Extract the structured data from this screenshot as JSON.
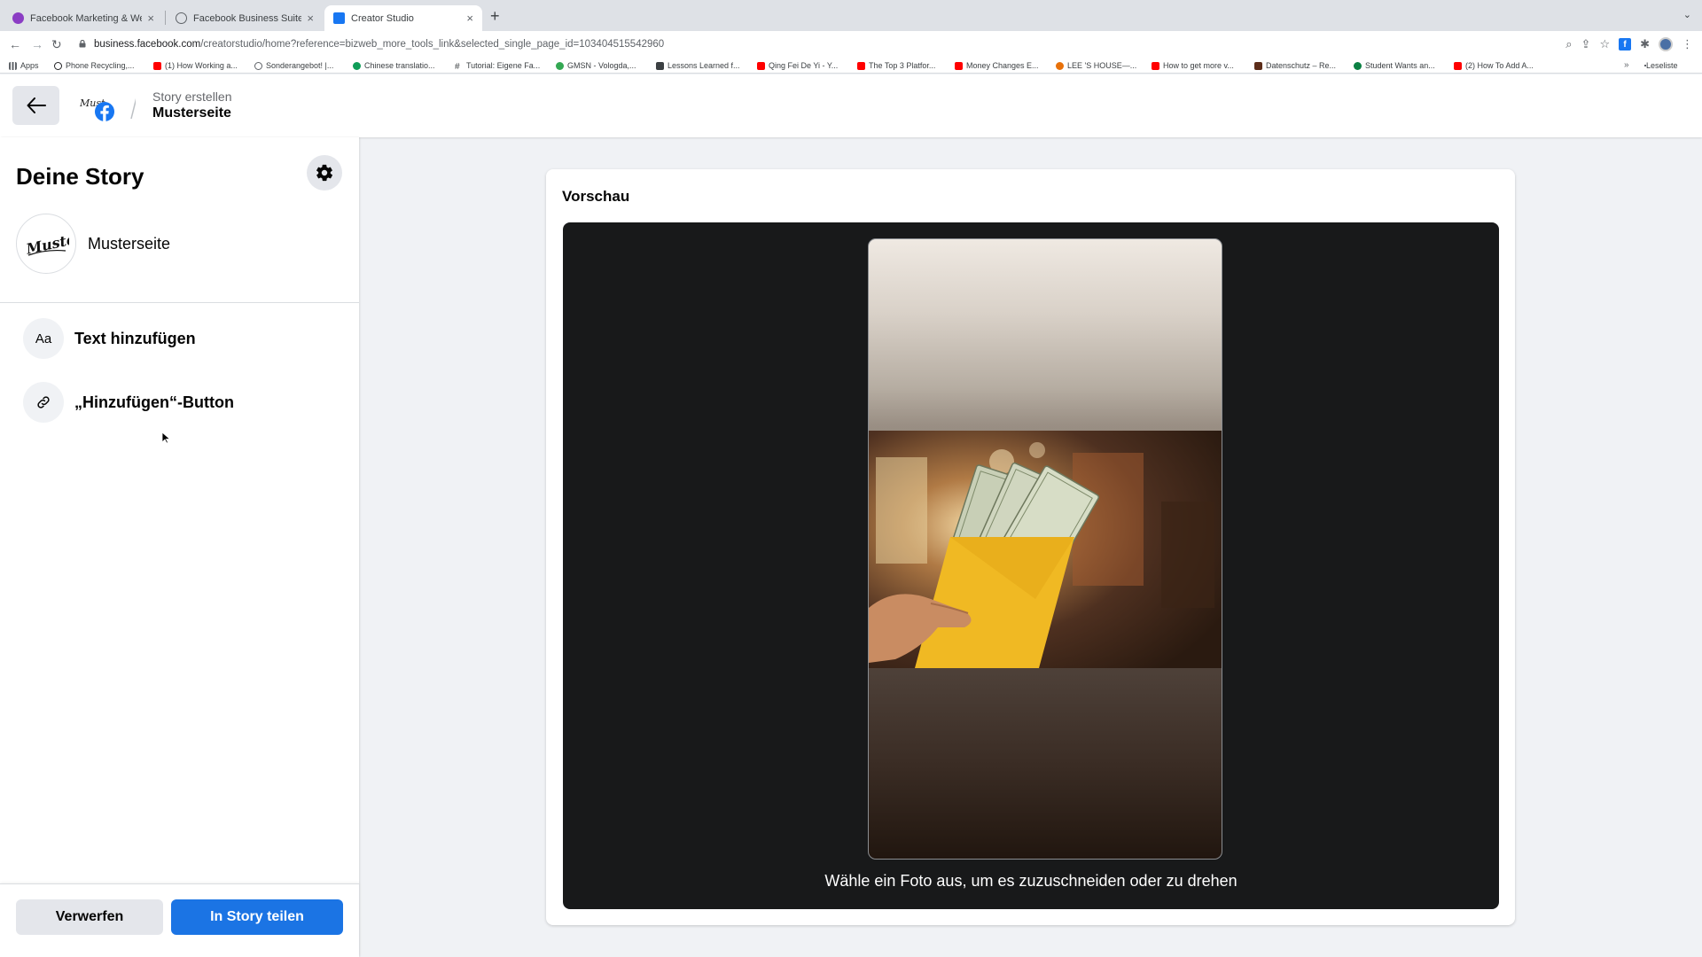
{
  "browser": {
    "tabs": [
      {
        "title": "Facebook Marketing & Werbe",
        "close": "×",
        "favicon_color": "#8b3dc4"
      },
      {
        "title": "Facebook Business Suite",
        "close": "×",
        "favicon_color": "#9aa0a6"
      },
      {
        "title": "Creator Studio",
        "close": "×",
        "favicon_color": "#1877f2"
      }
    ],
    "new_tab": "+",
    "tab_menu": "⌄",
    "nav": {
      "back": "←",
      "forward": "→",
      "reload": "↻"
    },
    "url_host": "business.facebook.com",
    "url_path": "/creatorstudio/home?reference=bizweb_more_tools_link&selected_single_page_id=103404515542960",
    "addr_icons": {
      "zoom": "⌕",
      "share": "⇪",
      "star": "☆",
      "fb_ext": "f",
      "puzzle": "✱",
      "menu": "⋮"
    },
    "bookmarks": [
      {
        "label": "Apps",
        "color": "#5f6368"
      },
      {
        "label": "Phone Recycling,...",
        "color": "#202124"
      },
      {
        "label": "(1) How Working a...",
        "color": "#ff0000"
      },
      {
        "label": "Sonderangebot! |...",
        "color": "#5f6368"
      },
      {
        "label": "Chinese translatio...",
        "color": "#0f9d58"
      },
      {
        "label": "Tutorial: Eigene Fa...",
        "color": "#3c4043"
      },
      {
        "label": "GMSN - Vologda,...",
        "color": "#34a853"
      },
      {
        "label": "Lessons Learned f...",
        "color": "#3c4043"
      },
      {
        "label": "Qing Fei De Yi - Y...",
        "color": "#ff0000"
      },
      {
        "label": "The Top 3 Platfor...",
        "color": "#ff0000"
      },
      {
        "label": "Money Changes E...",
        "color": "#ff0000"
      },
      {
        "label": "LEE 'S HOUSE—...",
        "color": "#e8710a"
      },
      {
        "label": "How to get more v...",
        "color": "#ff0000"
      },
      {
        "label": "Datenschutz – Re...",
        "color": "#5c2d1a"
      },
      {
        "label": "Student Wants an...",
        "color": "#0b8043"
      },
      {
        "label": "(2) How To Add A...",
        "color": "#ff0000"
      }
    ],
    "bookmarks_more": "»",
    "reading_list": "Leseliste"
  },
  "header": {
    "back_icon": "←",
    "breadcrumb_sub": "Story erstellen",
    "breadcrumb_title": "Musterseite"
  },
  "sidebar": {
    "title": "Deine Story",
    "page_name": "Musterseite",
    "avatar_text": "Muster",
    "items": [
      {
        "icon": "Aa",
        "label": "Text hinzufügen"
      },
      {
        "icon": "🔗",
        "label": "„Hinzufügen“-Button"
      }
    ],
    "discard_label": "Verwerfen",
    "share_label": "In Story teilen"
  },
  "preview": {
    "title": "Vorschau",
    "hint": "Wähle ein Foto aus, um es zuzuschneiden oder zu drehen"
  },
  "colors": {
    "primary": "#1b74e4",
    "secondary_button": "#e4e6eb",
    "stage_background": "#18191a",
    "page_background": "#f0f2f5"
  }
}
